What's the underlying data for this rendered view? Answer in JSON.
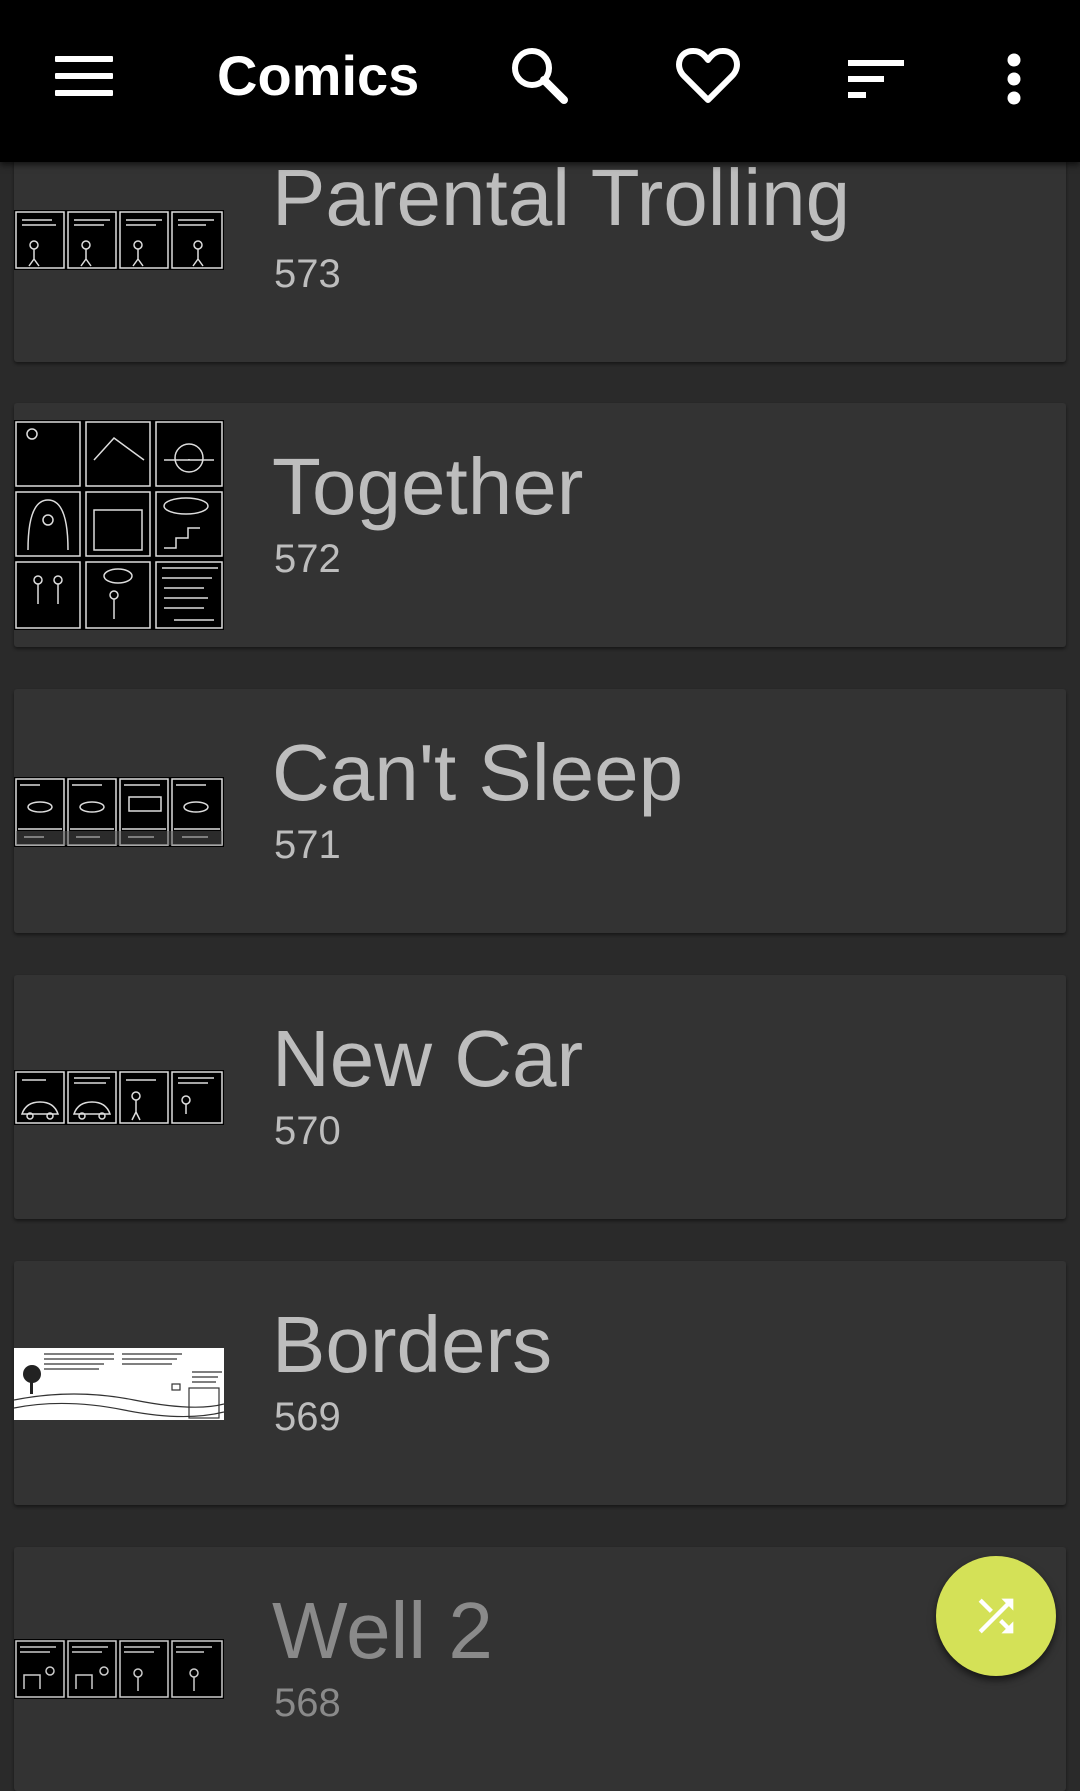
{
  "appbar": {
    "title": "Comics",
    "icons": [
      "menu-icon",
      "search-icon",
      "heart-icon",
      "sort-icon",
      "more-vert-icon"
    ]
  },
  "comics": [
    {
      "title": "Parental Trolling",
      "number": "573"
    },
    {
      "title": "Together",
      "number": "572"
    },
    {
      "title": "Can't Sleep",
      "number": "571"
    },
    {
      "title": "New Car",
      "number": "570"
    },
    {
      "title": "Borders",
      "number": "569"
    },
    {
      "title": "Well 2",
      "number": "568"
    }
  ],
  "fab": {
    "icon": "shuffle-icon"
  },
  "colors": {
    "appbar_bg": "#000000",
    "background": "#2a2a2a",
    "card_bg": "#333333",
    "text": "#bdbdbd",
    "fab": "#d4e157"
  }
}
